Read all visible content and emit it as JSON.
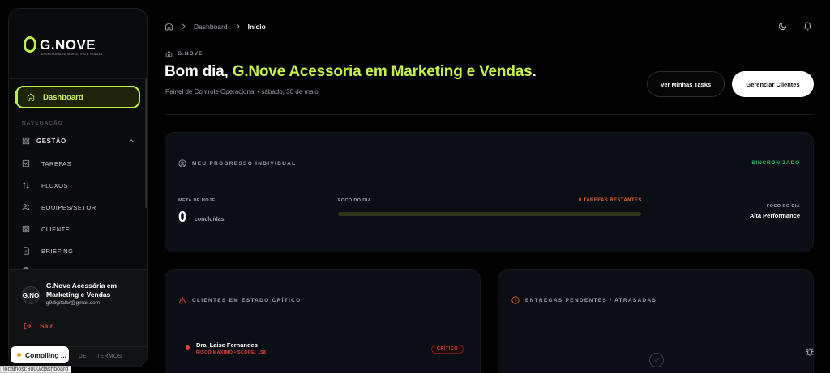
{
  "brand": {
    "name": "G.NOVE",
    "tagline": "ASSESSORIA EM MARKETING E VENDAS",
    "accent": "#b9f33b",
    "danger": "#e0433b",
    "success": "#29c36a"
  },
  "sidebar": {
    "active_item": "Dashboard",
    "section_label": "NAVEGAÇÃO",
    "group": {
      "label": "GESTÃO",
      "icon": "grid-icon",
      "expanded": true
    },
    "items": [
      {
        "label": "TAREFAS",
        "icon": "checkbox-icon"
      },
      {
        "label": "FLUXOS",
        "icon": "flow-icon"
      },
      {
        "label": "EQUIPES/SETOR",
        "icon": "users-icon"
      },
      {
        "label": "CLIENTE",
        "icon": "user-icon"
      },
      {
        "label": "BRIEFING",
        "icon": "document-icon"
      },
      {
        "label": "COMERCIAL",
        "icon": "briefcase-icon"
      }
    ],
    "user": {
      "avatar_text": "G.NO",
      "name": "G.Nove Acessória em Marketing e Vendas",
      "email": "g9digitalbr@gmail.com"
    },
    "logout_label": "Sair",
    "footer_links": [
      "DE",
      "TERMOS"
    ]
  },
  "dev": {
    "compiling_label": "Compiling ...",
    "status_url": "localhost:3000/dashboard"
  },
  "header": {
    "breadcrumb": [
      "Dashboard",
      "Início"
    ],
    "org_tag": "G.NOVE",
    "greeting_prefix": "Bom dia, ",
    "greeting_name": "G.Nove Acessoria em Marketing e Vendas",
    "greeting_suffix": ".",
    "subtitle": "Painel de Controle Operacional • sábado, 30 de maio",
    "btn_tasks": "Ver Minhas Tasks",
    "btn_clients": "Gerenciar Clientes"
  },
  "progress_card": {
    "title": "MEU PROGRESSO INDIVIDUAL",
    "sync_status": "SINCRONIZADO",
    "goal_label": "META DE HOJE",
    "goal_value": "0",
    "goal_unit": "concluídas",
    "focus_label": "FOCO DO DIA",
    "remaining": "0 TAREFAS RESTANTES",
    "progress_percent": 0,
    "focus_label_right": "FOCO DO DIA",
    "focus_value": "Alta Performance"
  },
  "critical_clients": {
    "title": "CLIENTES EM ESTADO CRÍTICO",
    "rows": [
      {
        "name": "Dra. Laise Fernandes",
        "detail": "RISCO MÁXIMO • SCORE: 158",
        "badge": "CRÍTICO"
      }
    ]
  },
  "deliveries": {
    "title": "ENTREGAS PENDENTES / ATRASADAS"
  }
}
